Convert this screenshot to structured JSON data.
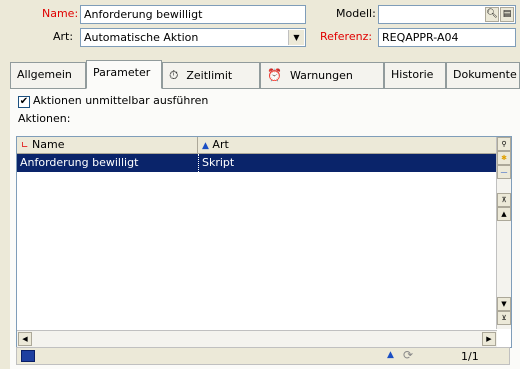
{
  "form": {
    "name_label": "Name:",
    "name_value": "Anforderung bewilligt",
    "modell_label": "Modell:",
    "modell_value": "",
    "art_label": "Art:",
    "art_value": "Automatische Aktion",
    "referenz_label": "Referenz:",
    "referenz_value": "REQAPPR-A04"
  },
  "tabs": [
    {
      "label": "Allgemein",
      "active": false
    },
    {
      "label": "Parameter",
      "active": true
    },
    {
      "label": "Zeitlimit",
      "icon": "stopwatch-icon",
      "active": false
    },
    {
      "label": "Warnungen",
      "icon": "alarm-clock-icon",
      "active": false
    },
    {
      "label": "Historie",
      "active": false
    },
    {
      "label": "Dokumente",
      "active": false
    }
  ],
  "options": {
    "execute_immediately_label": "Aktionen unmittelbar ausführen",
    "execute_immediately_checked": true
  },
  "actions": {
    "label": "Aktionen:",
    "columns": [
      "Name",
      "Art"
    ],
    "rows": [
      {
        "name": "Anforderung bewilligt",
        "art": "Skript",
        "selected": true
      }
    ]
  },
  "status": {
    "page_indicator": "1/1"
  },
  "colors": {
    "required_label": "#e00000",
    "selection": "#0a246a",
    "background": "#ece9d8"
  }
}
